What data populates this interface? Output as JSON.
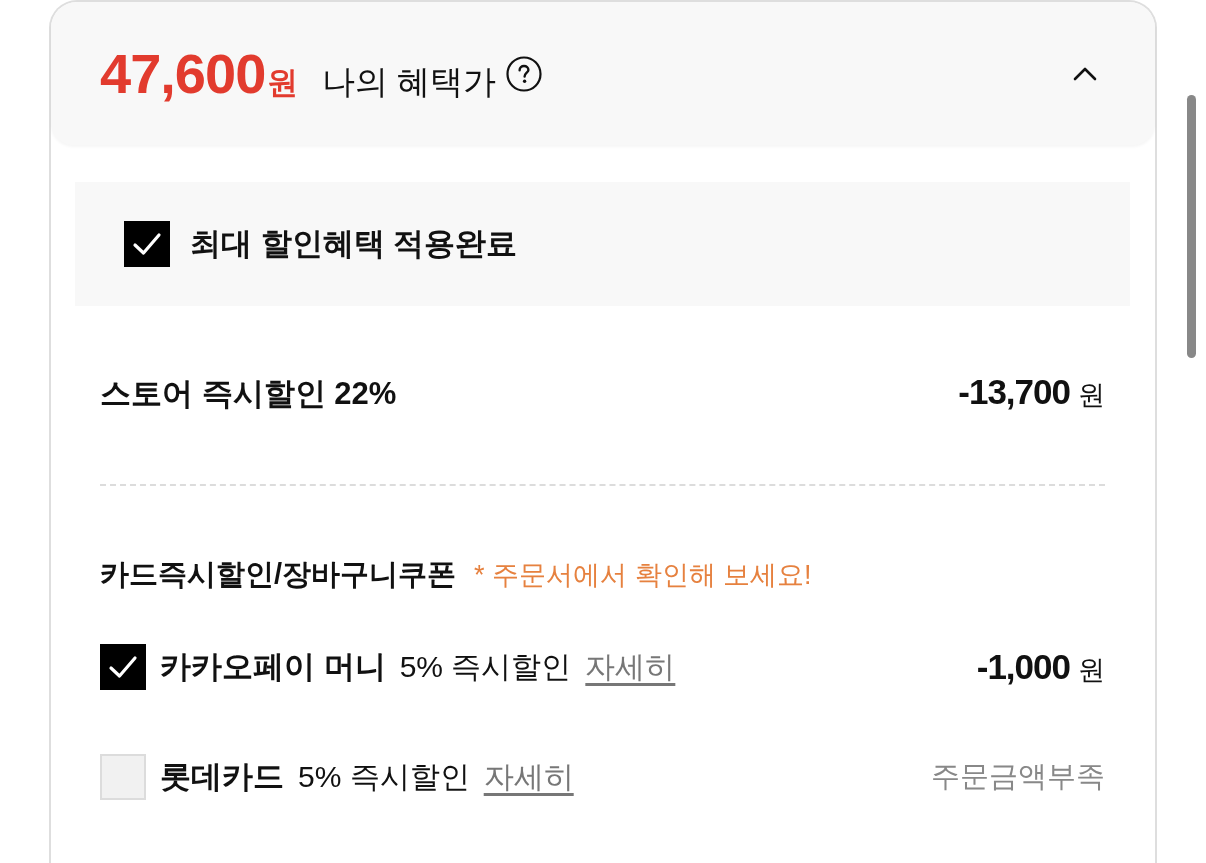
{
  "header": {
    "price": "47,600",
    "currency": "원",
    "label": "나의 혜택가",
    "expanded": true
  },
  "max_discount": {
    "checked": true,
    "label": "최대 할인혜택 적용완료"
  },
  "store_discount": {
    "label": "스토어 즉시할인 22%",
    "amount": "-13,700",
    "currency": "원"
  },
  "card_section": {
    "title": "카드즉시할인/장바구니쿠폰",
    "note": "* 주문서에서 확인해 보세요!",
    "items": [
      {
        "kind": "amount",
        "name": "카카오페이 머니",
        "offer": "5% 즉시할인",
        "link": "자세히",
        "checked": true,
        "amount": "-1,000",
        "currency": "원"
      },
      {
        "kind": "status",
        "name": "롯데카드",
        "offer": "5% 즉시할인",
        "link": "자세히",
        "checked": false,
        "status": "주문금액부족"
      }
    ]
  }
}
